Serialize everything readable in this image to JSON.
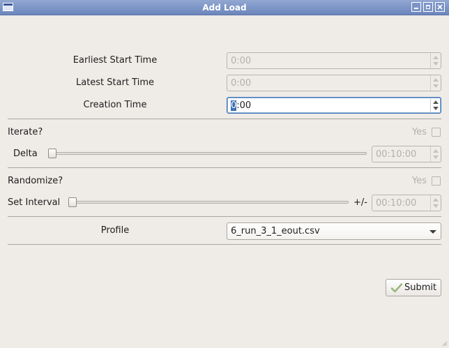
{
  "window": {
    "title": "Add Load"
  },
  "times": {
    "earliest_label": "Earliest Start Time",
    "earliest_value": "0:00",
    "latest_label": "Latest Start Time",
    "latest_value": "0:00",
    "creation_label": "Creation Time",
    "creation_value_selected": "0",
    "creation_value_rest": ":00"
  },
  "iterate": {
    "label": "Iterate?",
    "yes_label": "Yes",
    "checked": false,
    "delta_label": "Delta",
    "delta_value": "00:10:00",
    "slider_position": 0
  },
  "randomize": {
    "label": "Randomize?",
    "yes_label": "Yes",
    "checked": false,
    "interval_label": "Set Interval",
    "plusminus_label": "+/-",
    "interval_value": "00:10:00",
    "slider_position": 0
  },
  "profile": {
    "label": "Profile",
    "selected": "6_run_3_1_eout.csv"
  },
  "actions": {
    "submit_label": "Submit"
  },
  "colors": {
    "titlebar": "#7b93c6",
    "background": "#efebe7",
    "focus": "#3d74b5",
    "disabled_text": "#b3afab"
  }
}
